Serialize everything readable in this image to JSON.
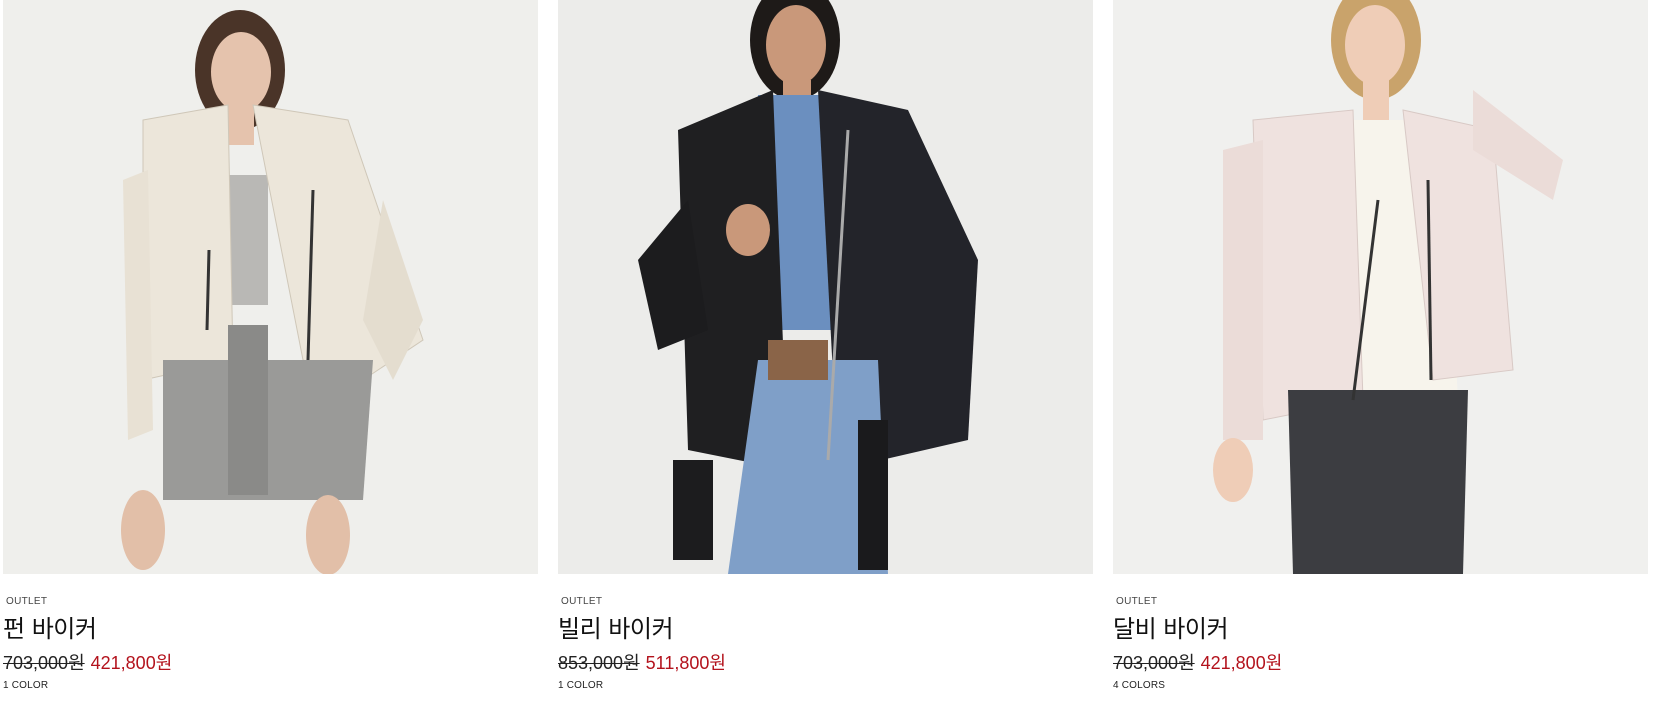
{
  "products": [
    {
      "badge": "OUTLET",
      "name": "펀 바이커",
      "was_price": "703,000원",
      "sale_price": "421,800원",
      "colors": "1 COLOR",
      "jacket_color": "#ece6da",
      "bottom_color": "#9a9a98"
    },
    {
      "badge": "OUTLET",
      "name": "빌리 바이커",
      "was_price": "853,000원",
      "sale_price": "511,800원",
      "colors": "1 COLOR",
      "jacket_color": "#1f1f21",
      "bottom_color": "#7f9fc8"
    },
    {
      "badge": "OUTLET",
      "name": "달비 바이커",
      "was_price": "703,000원",
      "sale_price": "421,800원",
      "colors": "4 COLORS",
      "jacket_color": "#efe2df",
      "bottom_color": "#3c3d41"
    }
  ],
  "theme": {
    "sale_color": "#b3121c",
    "text_color": "#111111"
  }
}
